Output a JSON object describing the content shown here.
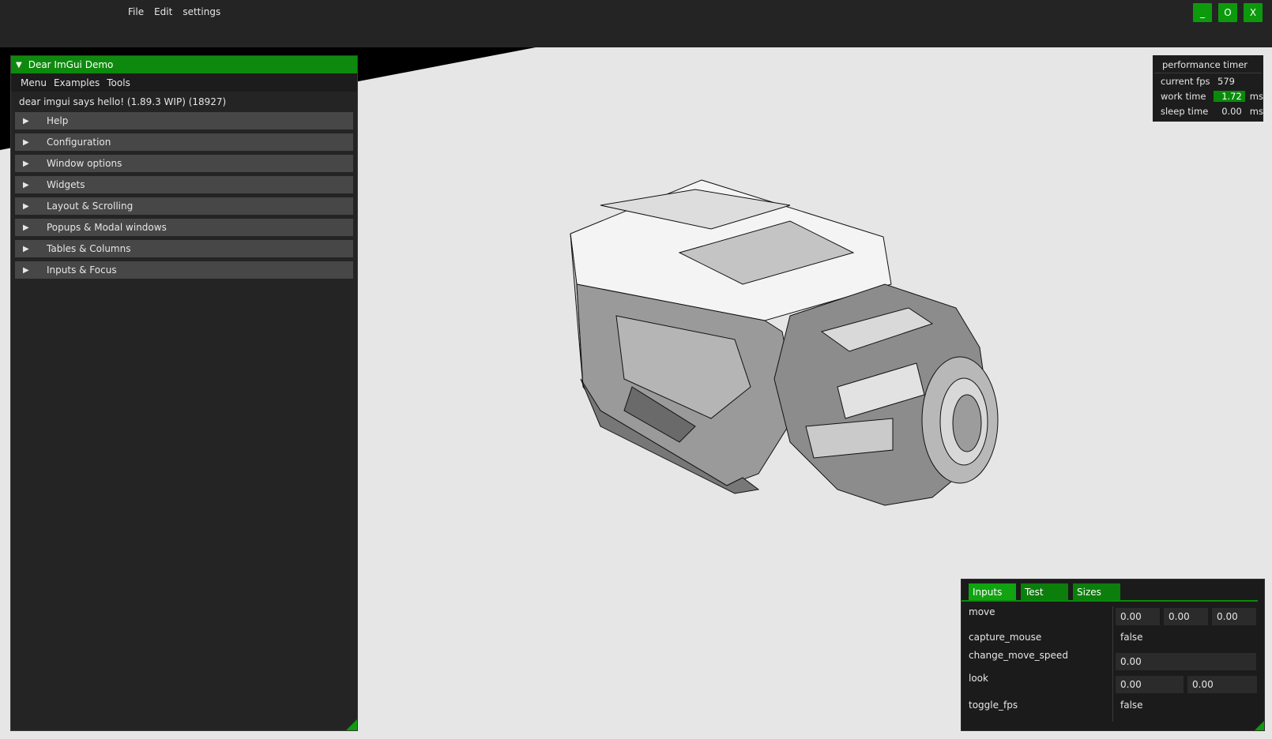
{
  "menubar": {
    "items": [
      "File",
      "Edit",
      "settings"
    ]
  },
  "window_controls": {
    "minimize": "_",
    "maximize": "O",
    "close": "X"
  },
  "demo": {
    "title": "Dear ImGui Demo",
    "menu": [
      "Menu",
      "Examples",
      "Tools"
    ],
    "hello": "dear imgui says hello! (1.89.3 WIP) (18927)",
    "sections": [
      "Help",
      "Configuration",
      "Window options",
      "Widgets",
      "Layout & Scrolling",
      "Popups & Modal windows",
      "Tables & Columns",
      "Inputs & Focus"
    ]
  },
  "perf": {
    "title": "performance timer",
    "fps_label": "current fps",
    "fps": "579",
    "work_label": "work time",
    "work": "1.72",
    "work_unit": "ms",
    "sleep_label": "sleep time",
    "sleep": "0.00",
    "sleep_unit": "ms"
  },
  "inputs_panel": {
    "tabs": [
      "Inputs",
      "Test",
      "Sizes"
    ],
    "move_label": "move",
    "move": [
      "0.00",
      "0.00",
      "0.00"
    ],
    "capture_mouse_label": "capture_mouse",
    "capture_mouse": "false",
    "change_move_speed_label": "change_move_speed",
    "change_move_speed": "0.00",
    "look_label": "look",
    "look": [
      "0.00",
      "0.00"
    ],
    "toggle_fps_label": "toggle_fps",
    "toggle_fps": "false"
  },
  "colors": {
    "accent": "#0d8a0d",
    "floor": "#e6e6e6",
    "background": "#242424"
  }
}
